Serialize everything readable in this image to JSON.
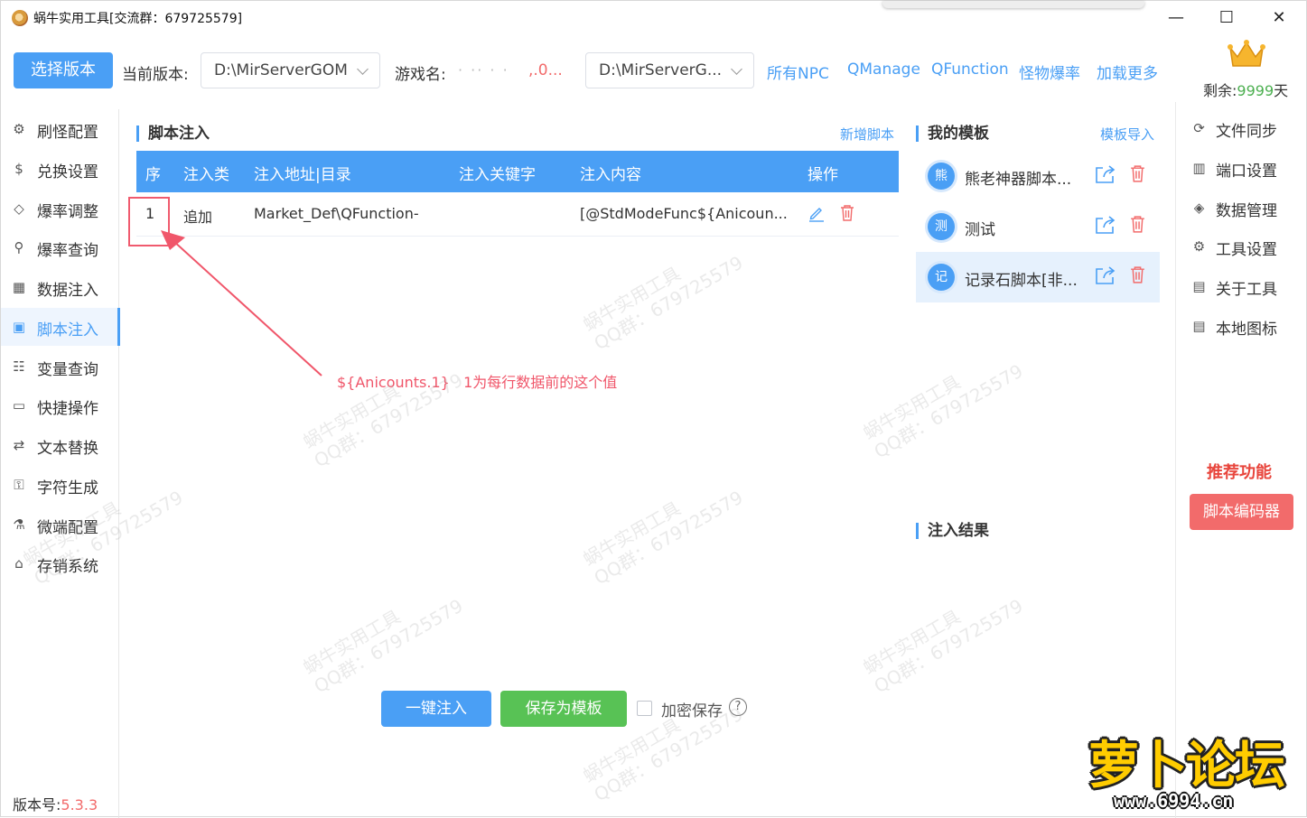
{
  "window": {
    "title": "蜗牛实用工具[交流群：679725579]",
    "minimize": "—",
    "maximize": "☐",
    "close": "✕"
  },
  "toolbar": {
    "select_version_button": "选择版本",
    "current_version_label": "当前版本:",
    "current_version_value": "D:\\MirServerGOM",
    "game_name_label": "游戏名:",
    "game_name_value_partial": ",.0...",
    "server_path_value": "D:\\MirServerG...",
    "links": [
      "所有NPC",
      "QManage",
      "QFunction",
      "怪物爆率",
      "加载更多"
    ],
    "remaining_label": "剩余:",
    "remaining_value": "9999",
    "remaining_unit": "天"
  },
  "sidebar": {
    "items": [
      {
        "label": "刷怪配置",
        "icon": "monster-icon"
      },
      {
        "label": "兑换设置",
        "icon": "dollar-icon"
      },
      {
        "label": "爆率调整",
        "icon": "cube-icon"
      },
      {
        "label": "爆率查询",
        "icon": "search-icon"
      },
      {
        "label": "数据注入",
        "icon": "grid-icon"
      },
      {
        "label": "脚本注入",
        "icon": "script-icon",
        "active": true
      },
      {
        "label": "变量查询",
        "icon": "variable-icon"
      },
      {
        "label": "快捷操作",
        "icon": "folder-icon"
      },
      {
        "label": "文本替换",
        "icon": "replace-icon"
      },
      {
        "label": "字符生成",
        "icon": "lock-icon"
      },
      {
        "label": "微端配置",
        "icon": "microscope-icon"
      },
      {
        "label": "存销系统",
        "icon": "store-icon"
      }
    ],
    "version_label": "版本号:",
    "version_value": "5.3.3"
  },
  "script_panel": {
    "title": "脚本注入",
    "add_link": "新增脚本",
    "columns": [
      "序",
      "注入类",
      "注入地址|目录",
      "注入关键字",
      "注入内容",
      "操作"
    ],
    "rows": [
      {
        "index": "1",
        "type": "追加",
        "path": "Market_Def\\QFunction-",
        "keyword": "",
        "content": "[@StdModeFunc${Anicoun..."
      }
    ],
    "annotation": "${Anicounts.1}   1为每行数据前的这个值",
    "inject_button": "一键注入",
    "save_template_button": "保存为模板",
    "encrypt_label": "加密保存",
    "help": "?"
  },
  "templates": {
    "title": "我的模板",
    "import_link": "模板导入",
    "items": [
      {
        "badge": "熊",
        "name": "熊老神器脚本..."
      },
      {
        "badge": "测",
        "name": "测试"
      },
      {
        "badge": "记",
        "name": "记录石脚本[非...",
        "selected": true
      }
    ],
    "result_title": "注入结果"
  },
  "right_menu": {
    "items": [
      {
        "label": "文件同步",
        "icon": "sync-icon"
      },
      {
        "label": "端口设置",
        "icon": "port-icon"
      },
      {
        "label": "数据管理",
        "icon": "box-icon"
      },
      {
        "label": "工具设置",
        "icon": "gear-icon"
      },
      {
        "label": "关于工具",
        "icon": "clipboard-icon"
      },
      {
        "label": "本地图标",
        "icon": "clipboard-icon"
      }
    ],
    "recommend_title": "推荐功能",
    "encoder_button": "脚本编码器"
  },
  "watermark": {
    "line1": "蜗牛实用工具",
    "line2": "QQ群：679725579"
  },
  "forum_logo": {
    "name": "萝卜论坛",
    "url": "www.6994.cn"
  },
  "colors": {
    "accent": "#4a9ff5",
    "success": "#58c255",
    "danger": "#f26b6b",
    "annotation": "#f0566a"
  }
}
